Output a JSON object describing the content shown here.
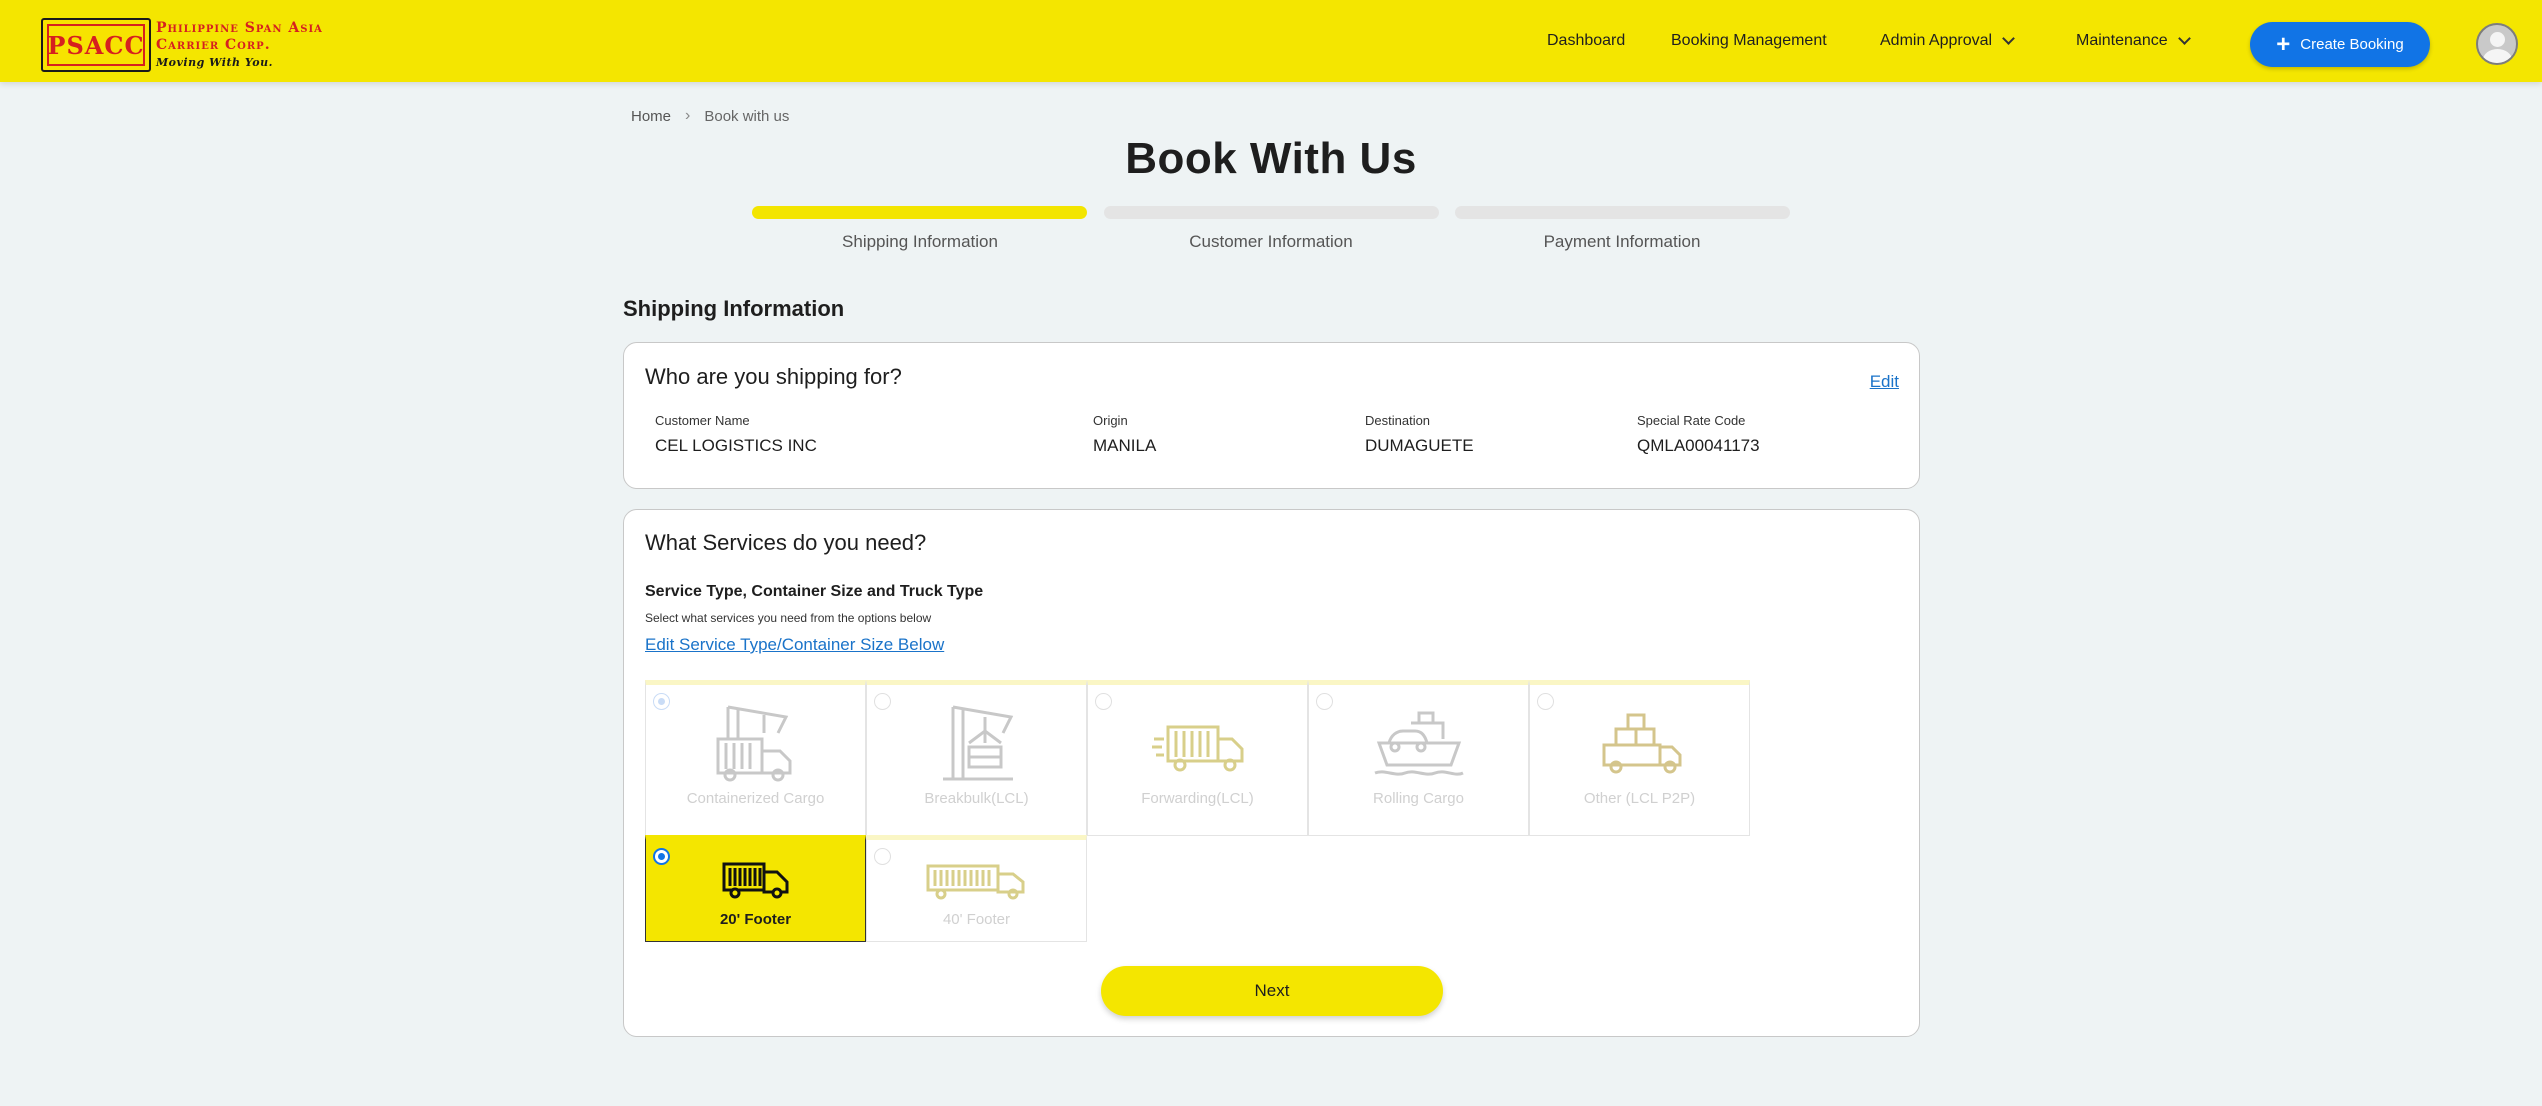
{
  "header": {
    "logo_text": "PSACC",
    "brand_line1": "Philippine Span Asia",
    "brand_line2": "Carrier Corp.",
    "brand_tagline": "Moving With You.",
    "nav": [
      {
        "label": "Dashboard"
      },
      {
        "label": "Booking Management"
      },
      {
        "label": "Admin Approval"
      },
      {
        "label": "Maintenance"
      }
    ],
    "create_label": "Create Booking"
  },
  "breadcrumb": {
    "home": "Home",
    "current": "Book with us"
  },
  "page_title": "Book With Us",
  "steps": [
    {
      "label": "Shipping Information",
      "active": true
    },
    {
      "label": "Customer Information",
      "active": false
    },
    {
      "label": "Payment Information",
      "active": false
    }
  ],
  "section_title": "Shipping Information",
  "shipping_for": {
    "title": "Who are you shipping for?",
    "edit_label": "Edit",
    "fields": [
      {
        "label": "Customer Name",
        "value": "CEL LOGISTICS INC"
      },
      {
        "label": "Origin",
        "value": "MANILA"
      },
      {
        "label": "Destination",
        "value": "DUMAGUETE"
      },
      {
        "label": "Special Rate Code",
        "value": "QMLA00041173"
      }
    ]
  },
  "services": {
    "title": "What Services do you need?",
    "heading": "Service Type, Container Size and Truck Type",
    "sub": "Select what services you need from the options below",
    "edit_link": "Edit Service Type/Container Size Below",
    "service_types": [
      {
        "label": "Containerized Cargo",
        "icon": "crane-container-truck-icon",
        "selected": true
      },
      {
        "label": "Breakbulk(LCL)",
        "icon": "crane-pallet-icon",
        "selected": false
      },
      {
        "label": "Forwarding(LCL)",
        "icon": "forwarding-truck-icon",
        "selected": false
      },
      {
        "label": "Rolling Cargo",
        "icon": "ship-car-icon",
        "selected": false
      },
      {
        "label": "Other (LCL P2P)",
        "icon": "boxes-truck-icon",
        "selected": false
      }
    ],
    "container_sizes": [
      {
        "label": "20' Footer",
        "icon": "truck-20ft-icon",
        "selected": true
      },
      {
        "label": "40' Footer",
        "icon": "truck-40ft-icon",
        "selected": false
      }
    ],
    "next_label": "Next"
  },
  "colors": {
    "brand_yellow": "#f4e600",
    "brand_red": "#d6201f",
    "primary_blue": "#1174e6"
  }
}
